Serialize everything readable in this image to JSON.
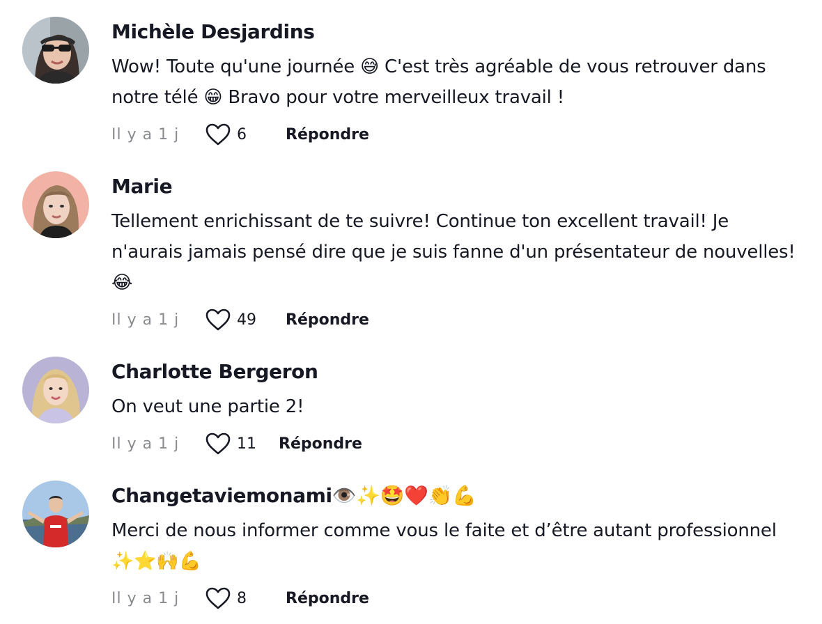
{
  "comments": [
    {
      "username": "Michèle Desjardins",
      "text": "Wow! Toute qu'une journée 😅 C'est très agréable de vous retrouver dans notre télé 😁 Bravo pour votre merveilleux travail !",
      "time": "Il y a 1 j",
      "likes": "6",
      "reply_label": "Répondre",
      "avatar_icon": "avatar-woman-sunglasses"
    },
    {
      "username": "Marie",
      "text": "Tellement enrichissant de te suivre! Continue ton excellent travail! Je n'aurais jamais pensé dire que je suis fanne d'un présentateur de nouvelles!😂",
      "time": "Il y a 1 j",
      "likes": "49",
      "reply_label": "Répondre",
      "avatar_icon": "avatar-woman-pink-background"
    },
    {
      "username": "Charlotte Bergeron",
      "text": "On veut une partie 2!",
      "time": "Il y a 1 j",
      "likes": "11",
      "reply_label": "Répondre",
      "avatar_icon": "avatar-woman-blonde"
    },
    {
      "username": "Changetaviemonami👁️✨🤩❤️👏💪",
      "text": "Merci de nous informer comme vous le faite et d’être autant professionnel ✨⭐🙌💪",
      "time": "Il y a 1 j",
      "likes": "8",
      "reply_label": "Répondre",
      "avatar_icon": "avatar-man-red-shirt"
    }
  ],
  "icons": {
    "like": "heart-outline-icon"
  },
  "colors": {
    "text": "#161823",
    "muted": "#8a8b91",
    "background": "#ffffff"
  }
}
